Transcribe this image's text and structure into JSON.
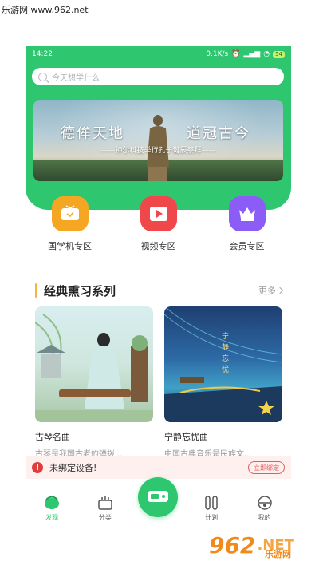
{
  "watermark": {
    "site": "乐游网 www.962.net",
    "logo_number": "962",
    "logo_suffix": ".NET",
    "logo_cn": "乐游网"
  },
  "status_bar": {
    "time": "14:22",
    "speed": "0.1K/s",
    "battery": "54"
  },
  "search": {
    "placeholder": "今天想学什么"
  },
  "banner": {
    "title_left": "德侔天地",
    "title_right": "道冠古今",
    "subtitle": "——神尔科技举行孔子诞辰祭拜——"
  },
  "zones": [
    {
      "label": "国学机专区",
      "icon": "tv-icon",
      "color": "#f5a623"
    },
    {
      "label": "视频专区",
      "icon": "video-icon",
      "color": "#f0474b"
    },
    {
      "label": "会员专区",
      "icon": "crown-icon",
      "color": "#8b5cf6"
    }
  ],
  "section": {
    "title": "经典熏习系列",
    "more": "更多"
  },
  "cards": [
    {
      "title": "古琴名曲",
      "desc": "古琴是我国古老的弹拨..."
    },
    {
      "title": "宁静忘忧曲",
      "desc": "中国古典音乐是民族文..."
    }
  ],
  "notice": {
    "text": "未绑定设备!",
    "button": "立即绑定"
  },
  "tabs": [
    {
      "label": "发现",
      "icon": "discover-icon"
    },
    {
      "label": "分类",
      "icon": "category-icon"
    },
    {
      "label": "",
      "icon": "device-icon"
    },
    {
      "label": "计划",
      "icon": "plan-icon"
    },
    {
      "label": "我的",
      "icon": "profile-icon"
    }
  ],
  "colors": {
    "primary": "#2ec770",
    "accent": "#f3b73b",
    "alert": "#e23b3b"
  }
}
